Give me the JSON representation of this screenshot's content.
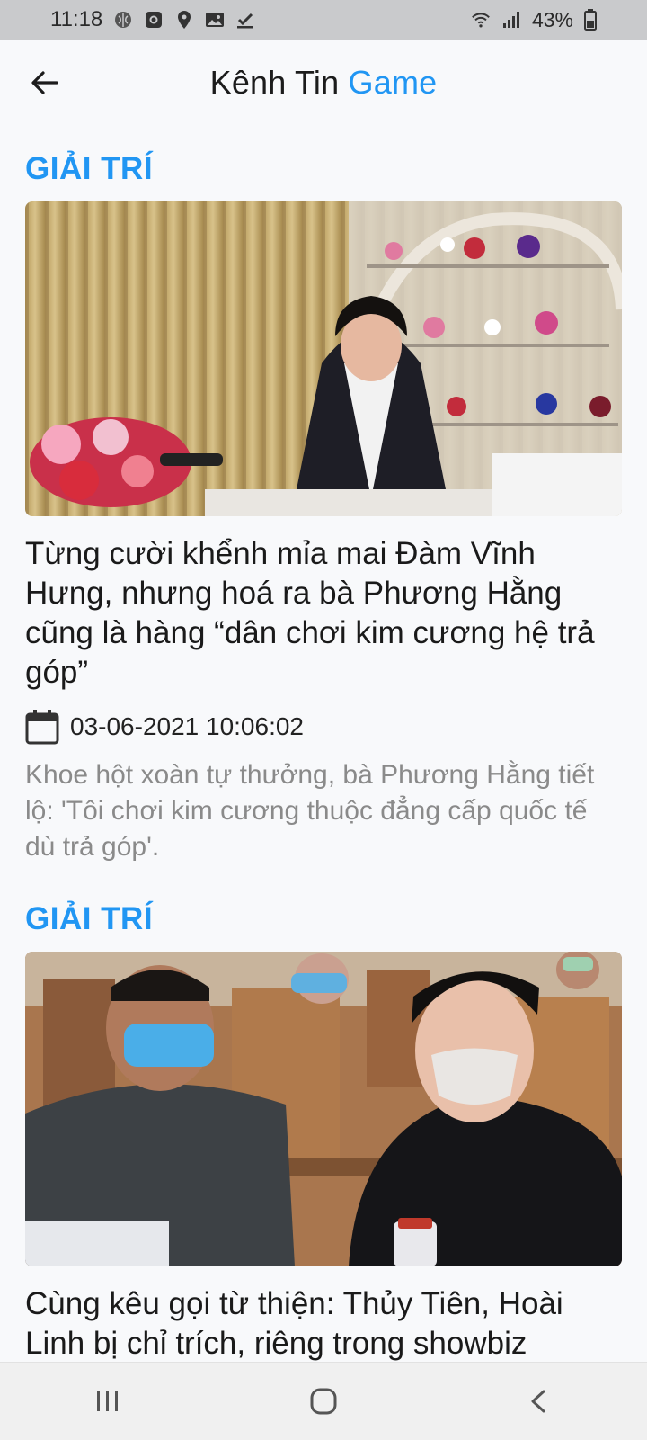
{
  "status_bar": {
    "time": "11:18",
    "battery": "43%",
    "icons_left": [
      "brain-icon",
      "instagram-icon",
      "location-icon",
      "image-icon",
      "download-check-icon"
    ],
    "icons_right": [
      "wifi-icon",
      "signal-icon",
      "battery-icon"
    ]
  },
  "header": {
    "title_main": "Kênh Tin",
    "title_accent": "Game",
    "accent_color": "#2196f3",
    "back_icon": "arrow-left-icon"
  },
  "articles": [
    {
      "category": "GIẢI TRÍ",
      "headline": "Từng cười khểnh mỉa mai Đàm Vĩnh Hưng, nhưng hoá ra bà Phương Hằng cũng là hàng “dân chơi kim cương hệ trả góp”",
      "date": "03-06-2021 10:06:02",
      "summary": "Khoe hột xoàn tự thưởng, bà Phương Hằng tiết lộ: 'Tôi chơi kim cương thuộc đẳng cấp quốc tế dù trả góp'."
    },
    {
      "category": "GIẢI TRÍ",
      "headline": "Cùng kêu gọi từ thiện: Thủy Tiên, Hoài Linh bị chỉ trích, riêng trong showbiz"
    }
  ],
  "nav": {
    "recent_icon": "recent-apps-icon",
    "home_icon": "home-icon",
    "back_icon": "back-chevron-icon"
  }
}
